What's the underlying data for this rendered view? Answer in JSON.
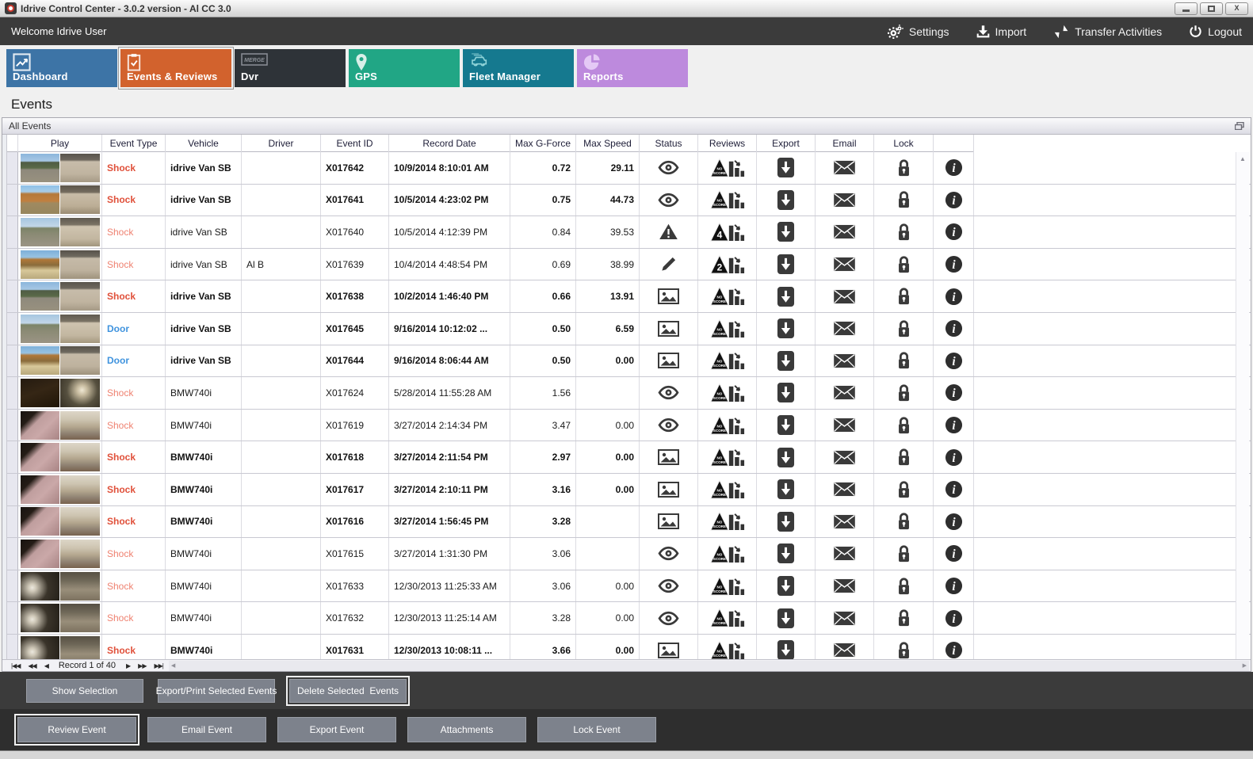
{
  "window": {
    "title": "Idrive Control Center - 3.0.2 version - Al CC 3.0",
    "controls": [
      "minimize",
      "maximize",
      "close"
    ]
  },
  "toolbar": {
    "welcome": "Welcome Idrive User",
    "actions": [
      {
        "label": "Settings",
        "icon": "gear"
      },
      {
        "label": "Import",
        "icon": "import"
      },
      {
        "label": "Transfer Activities",
        "icon": "transfer"
      },
      {
        "label": "Logout",
        "icon": "power"
      }
    ]
  },
  "tabs": [
    {
      "label": "Dashboard",
      "color": "#3d74a6",
      "icon": "chart",
      "selected": false
    },
    {
      "label": "Events & Reviews",
      "color": "#d2622d",
      "icon": "clipboard",
      "selected": true
    },
    {
      "label": "Dvr",
      "color": "#2e3338",
      "icon": "merge",
      "selected": false
    },
    {
      "label": "GPS",
      "color": "#21a685",
      "icon": "pin",
      "selected": false
    },
    {
      "label": "Fleet Manager",
      "color": "#15798f",
      "icon": "fleet",
      "selected": false
    },
    {
      "label": "Reports",
      "color": "#bd8add",
      "icon": "pie",
      "selected": false
    }
  ],
  "page": {
    "heading": "Events",
    "panel_title": "All Events"
  },
  "table": {
    "columns": [
      {
        "label": ""
      },
      {
        "label": "Play"
      },
      {
        "label": "Event Type"
      },
      {
        "label": "Vehicle"
      },
      {
        "label": "Driver"
      },
      {
        "label": "Event ID"
      },
      {
        "label": "Record Date"
      },
      {
        "label": "Max G-Force"
      },
      {
        "label": "Max Speed"
      },
      {
        "label": "Status"
      },
      {
        "label": "Reviews"
      },
      {
        "label": "Export"
      },
      {
        "label": "Email"
      },
      {
        "label": "Lock"
      },
      {
        "label": ""
      }
    ]
  },
  "rows": [
    {
      "bold": true,
      "type": "Shock",
      "vehicle": "idrive Van SB",
      "driver": "",
      "event_id": "X017642",
      "record_date": "10/9/2014 8:10:01 AM",
      "max_g": "0.72",
      "max_speed": "29.11",
      "status": "eye",
      "review": "NO SCORE",
      "thumb": "van1"
    },
    {
      "bold": true,
      "type": "Shock",
      "vehicle": "idrive Van SB",
      "driver": "",
      "event_id": "X017641",
      "record_date": "10/5/2014 4:23:02 PM",
      "max_g": "0.75",
      "max_speed": "44.73",
      "status": "eye",
      "review": "NO SCORE",
      "thumb": "van2"
    },
    {
      "bold": false,
      "type": "Shock",
      "vehicle": "idrive Van SB",
      "driver": "",
      "event_id": "X017640",
      "record_date": "10/5/2014 4:12:39 PM",
      "max_g": "0.84",
      "max_speed": "39.53",
      "status": "warning",
      "review": "4",
      "thumb": "van3"
    },
    {
      "bold": false,
      "type": "Shock",
      "vehicle": "idrive Van SB",
      "driver": "Al B",
      "event_id": "X017639",
      "record_date": "10/4/2014 4:48:54 PM",
      "max_g": "0.69",
      "max_speed": "38.99",
      "status": "pencil",
      "review": "2",
      "thumb": "van4"
    },
    {
      "bold": true,
      "type": "Shock",
      "vehicle": "idrive Van SB",
      "driver": "",
      "event_id": "X017638",
      "record_date": "10/2/2014 1:46:40 PM",
      "max_g": "0.66",
      "max_speed": "13.91",
      "status": "picture",
      "review": "NO SCORE",
      "thumb": "van1"
    },
    {
      "bold": true,
      "type": "Door",
      "vehicle": "idrive Van SB",
      "driver": "",
      "event_id": "X017645",
      "record_date": "9/16/2014 10:12:02 ...",
      "max_g": "0.50",
      "max_speed": "6.59",
      "status": "picture",
      "review": "NO SCORE",
      "thumb": "van3"
    },
    {
      "bold": true,
      "type": "Door",
      "vehicle": "idrive Van SB",
      "driver": "",
      "event_id": "X017644",
      "record_date": "9/16/2014 8:06:44 AM",
      "max_g": "0.50",
      "max_speed": "0.00",
      "status": "picture",
      "review": "NO SCORE",
      "thumb": "van4"
    },
    {
      "bold": false,
      "type": "Shock",
      "vehicle": "BMW740i",
      "driver": "",
      "event_id": "X017624",
      "record_date": "5/28/2014 11:55:28 AM",
      "max_g": "1.56",
      "max_speed": "",
      "status": "eye",
      "review": "NO SCORE",
      "thumb": "bmw1"
    },
    {
      "bold": false,
      "type": "Shock",
      "vehicle": "BMW740i",
      "driver": "",
      "event_id": "X017619",
      "record_date": "3/27/2014 2:14:34 PM",
      "max_g": "3.47",
      "max_speed": "0.00",
      "status": "eye",
      "review": "NO SCORE",
      "thumb": "bmw2"
    },
    {
      "bold": true,
      "type": "Shock",
      "vehicle": "BMW740i",
      "driver": "",
      "event_id": "X017618",
      "record_date": "3/27/2014 2:11:54 PM",
      "max_g": "2.97",
      "max_speed": "0.00",
      "status": "picture",
      "review": "NO SCORE",
      "thumb": "bmw2"
    },
    {
      "bold": true,
      "type": "Shock",
      "vehicle": "BMW740i",
      "driver": "",
      "event_id": "X017617",
      "record_date": "3/27/2014 2:10:11 PM",
      "max_g": "3.16",
      "max_speed": "0.00",
      "status": "picture",
      "review": "NO SCORE",
      "thumb": "bmw2"
    },
    {
      "bold": true,
      "type": "Shock",
      "vehicle": "BMW740i",
      "driver": "",
      "event_id": "X017616",
      "record_date": "3/27/2014 1:56:45 PM",
      "max_g": "3.28",
      "max_speed": "",
      "status": "picture",
      "review": "NO SCORE",
      "thumb": "bmw2"
    },
    {
      "bold": false,
      "type": "Shock",
      "vehicle": "BMW740i",
      "driver": "",
      "event_id": "X017615",
      "record_date": "3/27/2014 1:31:30 PM",
      "max_g": "3.06",
      "max_speed": "",
      "status": "eye",
      "review": "NO SCORE",
      "thumb": "bmw2"
    },
    {
      "bold": false,
      "type": "Shock",
      "vehicle": "BMW740i",
      "driver": "",
      "event_id": "X017633",
      "record_date": "12/30/2013 11:25:33 AM",
      "max_g": "3.06",
      "max_speed": "0.00",
      "status": "eye",
      "review": "NO SCORE",
      "thumb": "bmw3"
    },
    {
      "bold": false,
      "type": "Shock",
      "vehicle": "BMW740i",
      "driver": "",
      "event_id": "X017632",
      "record_date": "12/30/2013 11:25:14 AM",
      "max_g": "3.28",
      "max_speed": "0.00",
      "status": "eye",
      "review": "NO SCORE",
      "thumb": "bmw3"
    },
    {
      "bold": true,
      "type": "Shock",
      "vehicle": "BMW740i",
      "driver": "",
      "event_id": "X017631",
      "record_date": "12/30/2013 10:08:11 ...",
      "max_g": "3.66",
      "max_speed": "0.00",
      "status": "picture",
      "review": "NO SCORE",
      "thumb": "bmw3"
    }
  ],
  "record_nav": {
    "back_buttons": [
      "|◀◀",
      "◀◀",
      "◀"
    ],
    "label": "Record 1 of 40",
    "forward_buttons": [
      "▶",
      "▶▶",
      "▶▶|"
    ]
  },
  "selection_buttons": [
    {
      "label": "Show Selection",
      "focused": false
    },
    {
      "label": "Export/Print Selected Events",
      "focused": false
    },
    {
      "label": "Delete Selected  Events",
      "focused": true
    }
  ],
  "event_buttons": [
    {
      "label": "Review Event",
      "focused": true
    },
    {
      "label": "Email Event",
      "focused": false
    },
    {
      "label": "Export Event",
      "focused": false
    },
    {
      "label": "Attachments",
      "focused": false
    },
    {
      "label": "Lock Event",
      "focused": false
    }
  ],
  "colors": {
    "shock": "#e0503a",
    "shock_light": "#ef8271",
    "door": "#3f93de",
    "tab_selected": "#d2622d",
    "topbar": "#3b3b3b",
    "button": "#7d828c"
  }
}
